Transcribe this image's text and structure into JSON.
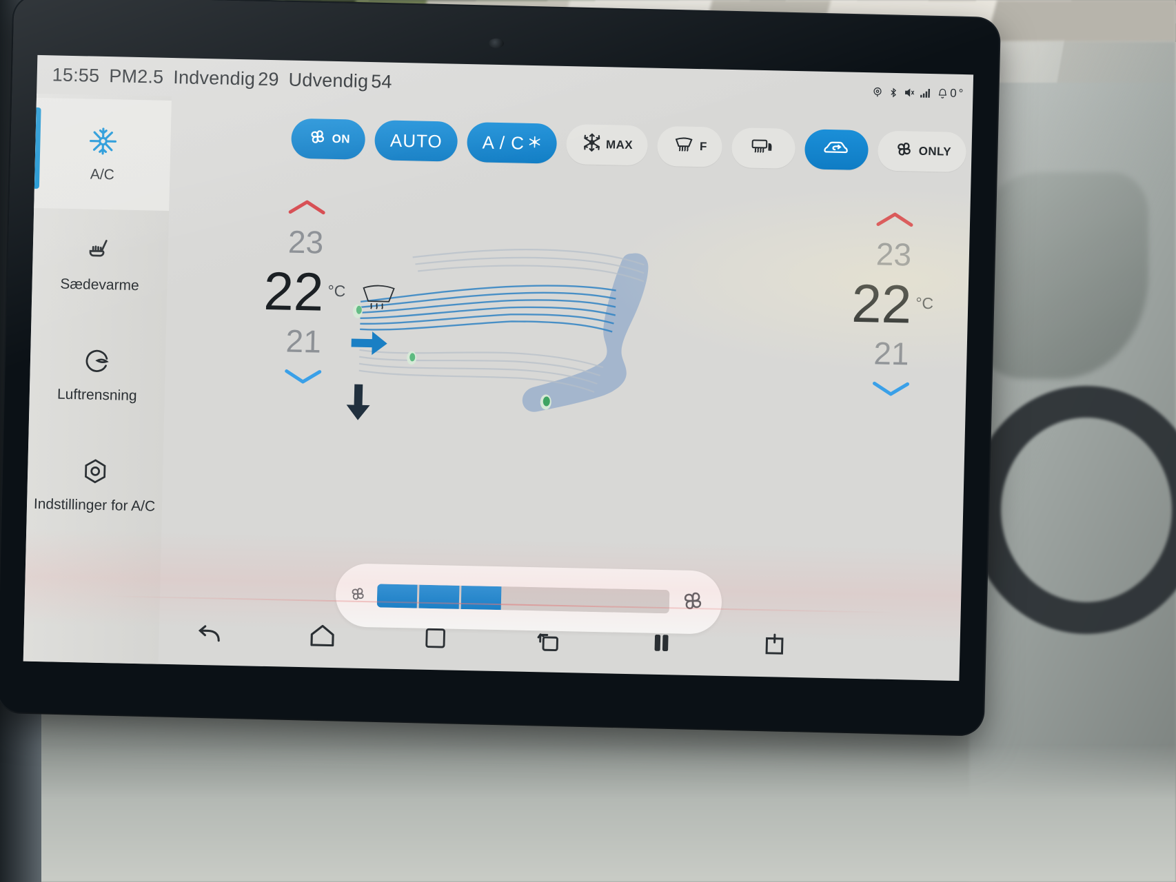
{
  "statusbar": {
    "time": "15:55",
    "pm_label": "PM2.5",
    "indoor_label": "Indvendig",
    "indoor_value": "29",
    "outdoor_label": "Udvendig",
    "outdoor_value": "54",
    "icons": [
      "location-icon",
      "bluetooth-icon",
      "mute-icon",
      "signal-icon",
      "notification-bell-icon"
    ],
    "exterior_temp": "0",
    "degree_symbol": "°"
  },
  "sidebar": {
    "items": [
      {
        "label": "A/C",
        "icon": "snowflake-fan-icon",
        "active": true
      },
      {
        "label": "Sædevarme",
        "icon": "seat-heat-icon",
        "active": false
      },
      {
        "label": "Luftrensning",
        "icon": "air-purify-icon",
        "active": false
      },
      {
        "label": "Indstillinger for A/C",
        "icon": "settings-gear-icon",
        "active": false
      }
    ],
    "accent_color": "#0f8fd0"
  },
  "modes": [
    {
      "id": "fan-on",
      "icon": "fan-icon",
      "label": "ON",
      "on": true
    },
    {
      "id": "auto",
      "icon": "",
      "label": "AUTO",
      "on": true
    },
    {
      "id": "ac",
      "icon": "snowflake-small-icon",
      "label": "A / C",
      "on": true
    },
    {
      "id": "max-cool",
      "icon": "snowflake-icon",
      "label": "MAX",
      "on": false
    },
    {
      "id": "front-defrost",
      "icon": "front-defrost-icon",
      "label": "F",
      "on": false
    },
    {
      "id": "rear-defrost",
      "icon": "rear-defrost-icon",
      "label": "",
      "on": false
    },
    {
      "id": "recirculate",
      "icon": "recirculation-icon",
      "label": "",
      "on": true
    },
    {
      "id": "fan-only",
      "icon": "fan-icon",
      "label": "ONLY",
      "on": false
    }
  ],
  "temperature": {
    "left": {
      "up": "23",
      "current": "22",
      "down": "21",
      "unit": "°C"
    },
    "right": {
      "up": "23",
      "current": "22",
      "down": "21",
      "unit": "°C"
    }
  },
  "fan": {
    "segments_total": 7,
    "segments_filled": 3,
    "min_icon": "fan-small-icon",
    "max_icon": "fan-large-icon"
  },
  "navbar": {
    "items": [
      {
        "id": "back",
        "icon": "back-arrow-icon"
      },
      {
        "id": "home",
        "icon": "home-icon"
      },
      {
        "id": "recents",
        "icon": "square-icon"
      },
      {
        "id": "screen-flip",
        "icon": "rotate-screen-icon"
      },
      {
        "id": "split",
        "icon": "pause-split-icon"
      },
      {
        "id": "power",
        "icon": "power-icon"
      }
    ]
  },
  "colors": {
    "accent_blue": "#1180ca",
    "screen_bg": "#d8d8d6",
    "text_dark": "#1b2024",
    "text_muted": "#8d9196",
    "hot_red": "#d64a4f",
    "cold_blue": "#3aa0e8"
  }
}
